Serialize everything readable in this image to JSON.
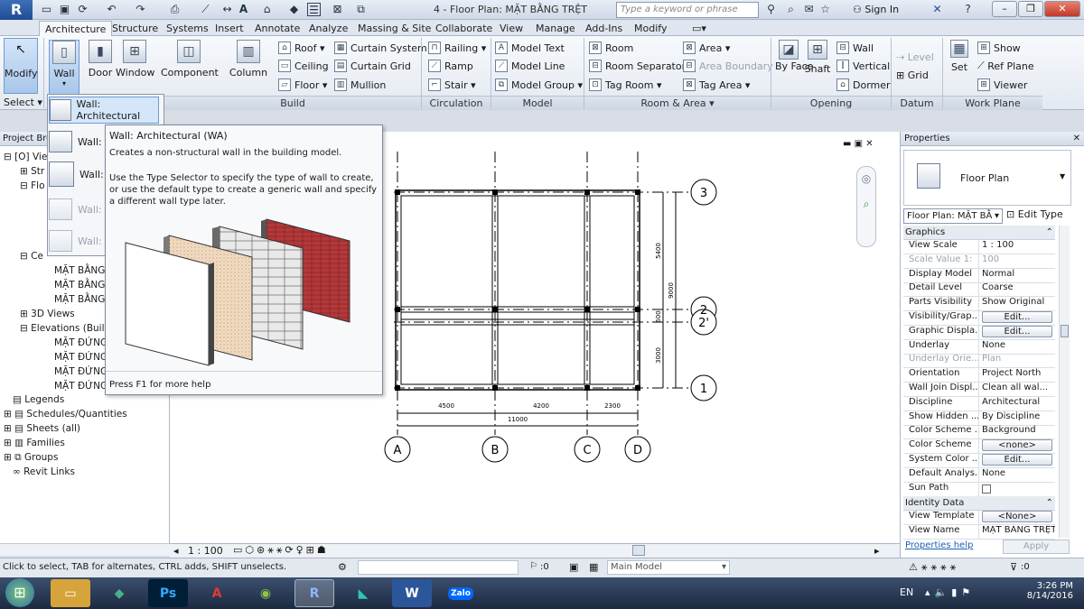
{
  "app": {
    "logo": "R",
    "doc_title": "4 - Floor Plan: MẶT BẰNG TRỆT"
  },
  "titlebar": {
    "search_placeholder": "Type a keyword or phrase",
    "sign_in": "Sign In"
  },
  "tabs": [
    "Architecture",
    "Structure",
    "Systems",
    "Insert",
    "Annotate",
    "Analyze",
    "Massing & Site",
    "Collaborate",
    "View",
    "Manage",
    "Add-Ins",
    "Modify"
  ],
  "ribbon": {
    "modify": "Modify",
    "select": "Select ▾",
    "build": {
      "wall": "Wall",
      "door": "Door",
      "window": "Window",
      "component": "Component",
      "column": "Column",
      "roof": "Roof",
      "ceiling": "Ceiling",
      "floor": "Floor",
      "curtain_system": "Curtain System",
      "curtain_grid": "Curtain Grid",
      "mullion": "Mullion",
      "label": "Build"
    },
    "circulation": {
      "railing": "Railing",
      "ramp": "Ramp",
      "stair": "Stair",
      "label": "Circulation"
    },
    "model": {
      "text": "Model Text",
      "line": "Model Line",
      "group": "Model Group",
      "label": "Model"
    },
    "room_area": {
      "room": "Room",
      "separator": "Room Separator",
      "tag_room": "Tag Room",
      "area": "Area",
      "area_boundary": "Area Boundary",
      "tag_area": "Tag Area",
      "label": "Room & Area ▾"
    },
    "opening": {
      "by_face": "By Face",
      "shaft": "Shaft",
      "wall": "Wall",
      "vertical": "Vertical",
      "dormer": "Dormer",
      "label": "Opening"
    },
    "datum": {
      "level": "Level",
      "grid": "Grid",
      "label": "Datum"
    },
    "work_plane": {
      "set": "Set",
      "show": "Show",
      "ref_plane": "Ref Plane",
      "viewer": "Viewer",
      "label": "Work Plane"
    }
  },
  "wall_menu": [
    "Wall: Architectural",
    "Wall: S",
    "Wall: b",
    "Wall: S",
    "Wall: I"
  ],
  "tooltip": {
    "title": "Wall: Architectural (WA)",
    "line1": "Creates a non-structural wall in the building model.",
    "line2": "Use the Type Selector to specify the type of wall to create, or use the default type to create a generic wall and specify a different wall type later.",
    "help": "Press F1 for more help"
  },
  "project_browser": {
    "title": "Project Bro",
    "items": [
      "Vie",
      "Str",
      "Flo",
      "Ce",
      "MẶT BẰNG",
      "MẶT BẰNG",
      "MẶT BẰNG",
      "3D Views",
      "Elevations (Buil",
      "MẶT ĐỨNG",
      "MẶT ĐỨNG",
      "MẶT ĐỨNG",
      "MẶT ĐỨNG",
      "Legends",
      "Schedules/Quantities",
      "Sheets (all)",
      "Families",
      "Groups",
      "Revit Links"
    ]
  },
  "drawing": {
    "grid_cols": [
      "A",
      "B",
      "C",
      "D"
    ],
    "grid_rows": [
      "3",
      "2",
      "2'",
      "1"
    ],
    "dims_x": [
      "4500",
      "4200",
      "2300"
    ],
    "dim_total": "11000",
    "dims_y": [
      "5400",
      "600",
      "3000"
    ],
    "dim_y_total": "9000",
    "scale": "1 : 100"
  },
  "properties": {
    "title": "Properties",
    "type_name": "Floor Plan",
    "selector": "Floor Plan: MẶT BẰ",
    "edit_type": "Edit Type",
    "section_graphics": "Graphics",
    "rows": [
      {
        "k": "View Scale",
        "v": "1 : 100"
      },
      {
        "k": "Scale Value   1:",
        "v": "100"
      },
      {
        "k": "Display Model",
        "v": "Normal"
      },
      {
        "k": "Detail Level",
        "v": "Coarse"
      },
      {
        "k": "Parts Visibility",
        "v": "Show Original"
      },
      {
        "k": "Visibility/Grap...",
        "v": "Edit..."
      },
      {
        "k": "Graphic Displa...",
        "v": "Edit..."
      },
      {
        "k": "Underlay",
        "v": "None"
      },
      {
        "k": "Underlay Orie...",
        "v": "Plan"
      },
      {
        "k": "Orientation",
        "v": "Project North"
      },
      {
        "k": "Wall Join Displ...",
        "v": "Clean all wal..."
      },
      {
        "k": "Discipline",
        "v": "Architectural"
      },
      {
        "k": "Show Hidden ...",
        "v": "By Discipline"
      },
      {
        "k": "Color Scheme ...",
        "v": "Background"
      },
      {
        "k": "Color Scheme",
        "v": "<none>"
      },
      {
        "k": "System Color ...",
        "v": "Edit..."
      },
      {
        "k": "Default Analys...",
        "v": "None"
      },
      {
        "k": "Sun Path",
        "v": ""
      }
    ],
    "section_identity": "Identity Data",
    "rows2": [
      {
        "k": "View Template",
        "v": "<None>"
      },
      {
        "k": "View Name",
        "v": "MẶT BẰNG TRỆT"
      }
    ],
    "help": "Properties help",
    "apply": "Apply"
  },
  "status": {
    "text": "Click to select, TAB for alternates, CTRL adds, SHIFT unselects.",
    "count": ":0",
    "workset": "Main Model",
    "filter_count": ":0"
  },
  "taskbar": {
    "lang": "EN",
    "time": "3:26 PM",
    "date": "8/14/2016",
    "zalo": "Zalo"
  },
  "colors": {
    "accent": "#3f6fb7",
    "brick": "#b4383a"
  }
}
